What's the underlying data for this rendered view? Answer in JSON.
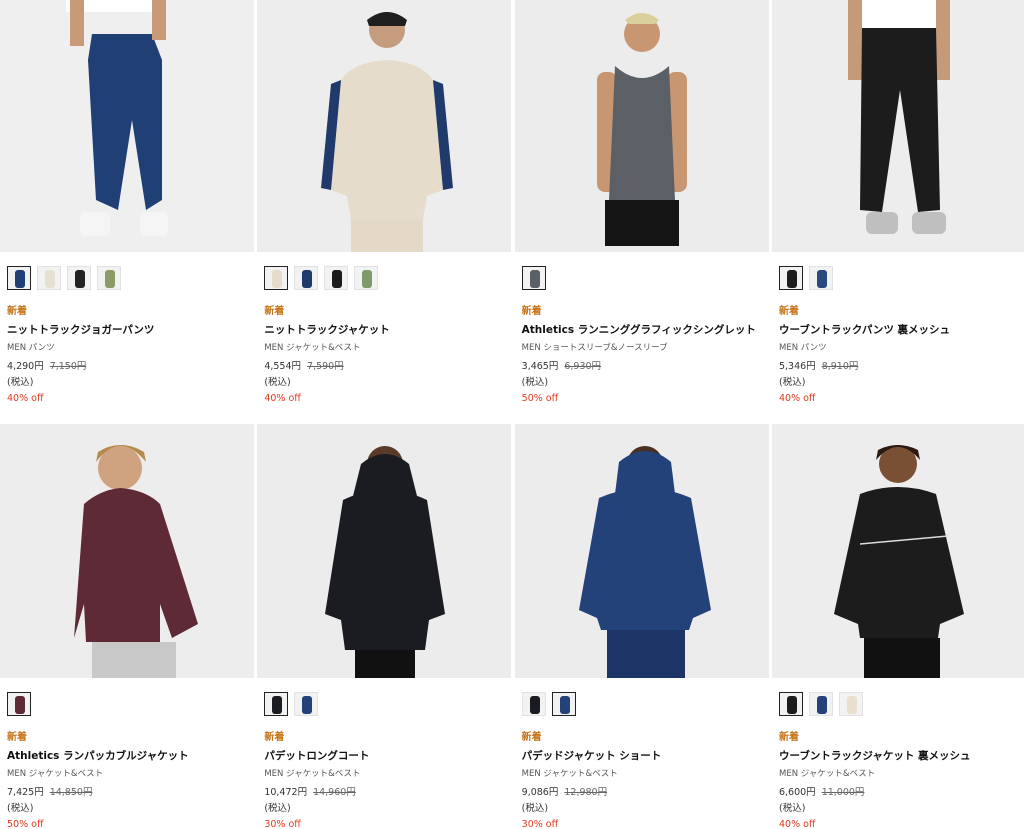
{
  "products": [
    {
      "badge": "新着",
      "name": "ニットトラックジョガーパンツ",
      "category": "MEN パンツ",
      "price": "4,290円",
      "original_price": "7,150円",
      "tax": "(税込)",
      "discount": "40% off",
      "image_icon": "navy-jogger-pants-model-photo",
      "swatch_colors": [
        "#1f3f75",
        "#e6e0d3",
        "#222222",
        "#8c9a66"
      ],
      "selected_swatch": 0
    },
    {
      "badge": "新着",
      "name": "ニットトラックジャケット",
      "category": "MEN ジャケット&ベスト",
      "price": "4,554円",
      "original_price": "7,590円",
      "tax": "(税込)",
      "discount": "40% off",
      "image_icon": "beige-track-jacket-model-photo",
      "swatch_colors": [
        "#e6dccb",
        "#1f3a6b",
        "#1b1b1b",
        "#7f9a6a"
      ],
      "selected_swatch": 0
    },
    {
      "badge": "新着",
      "name": "Athletics ランニンググラフィックシングレット",
      "category": "MEN ショートスリーブ&ノースリーブ",
      "price": "3,465円",
      "original_price": "6,930円",
      "tax": "(税込)",
      "discount": "50% off",
      "image_icon": "grey-singlet-model-photo",
      "swatch_colors": [
        "#5b6066"
      ],
      "selected_swatch": 0
    },
    {
      "badge": "新着",
      "name": "ウーブントラックパンツ 裏メッシュ",
      "category": "MEN パンツ",
      "price": "5,346円",
      "original_price": "8,910円",
      "tax": "(税込)",
      "discount": "40% off",
      "image_icon": "black-woven-pants-model-photo",
      "swatch_colors": [
        "#1c1c1c",
        "#2a4a7d"
      ],
      "selected_swatch": 0
    },
    {
      "badge": "新着",
      "name": "Athletics ランパッカブルジャケット",
      "category": "MEN ジャケット&ベスト",
      "price": "7,425円",
      "original_price": "14,850円",
      "tax": "(税込)",
      "discount": "50% off",
      "image_icon": "burgundy-packable-jacket-model-photo",
      "swatch_colors": [
        "#5e2a36"
      ],
      "selected_swatch": 0
    },
    {
      "badge": "新着",
      "name": "パデットロングコート",
      "category": "MEN ジャケット&ベスト",
      "price": "10,472円",
      "original_price": "14,960円",
      "tax": "(税込)",
      "discount": "30% off",
      "image_icon": "black-padded-long-coat-model-photo",
      "swatch_colors": [
        "#1a1c22",
        "#23427a"
      ],
      "selected_swatch": 0
    },
    {
      "badge": "新着",
      "name": "パデッドジャケット ショート",
      "category": "MEN ジャケット&ベスト",
      "price": "9,086円",
      "original_price": "12,980円",
      "tax": "(税込)",
      "discount": "30% off",
      "image_icon": "navy-padded-jacket-model-photo",
      "swatch_colors": [
        "#1a1c22",
        "#23427a"
      ],
      "selected_swatch": 1
    },
    {
      "badge": "新着",
      "name": "ウーブントラックジャケット 裏メッシュ",
      "category": "MEN ジャケット&ベスト",
      "price": "6,600円",
      "original_price": "11,000円",
      "tax": "(税込)",
      "discount": "40% off",
      "image_icon": "black-woven-jacket-model-photo",
      "swatch_colors": [
        "#1c1c1c",
        "#23427a",
        "#e8e0cc"
      ],
      "selected_swatch": 0
    }
  ]
}
